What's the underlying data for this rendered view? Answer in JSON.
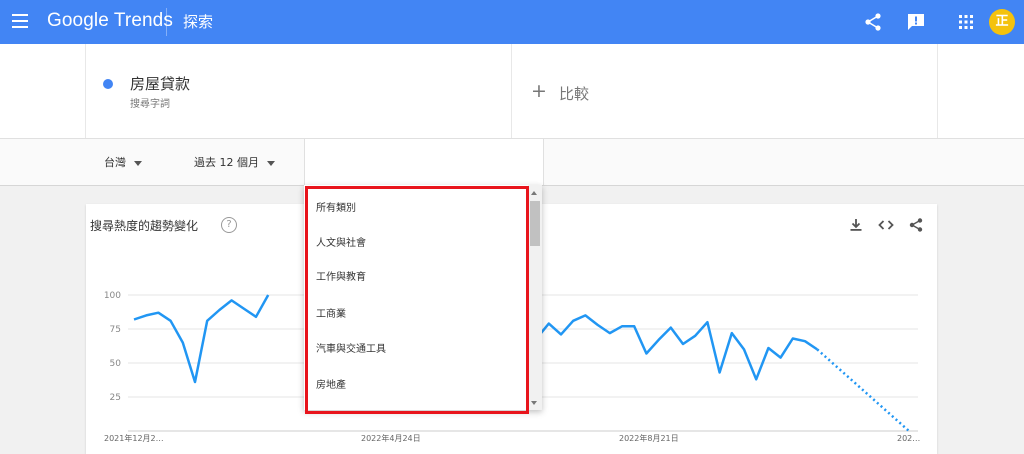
{
  "header": {
    "brand": "Google Trends",
    "section": "探索",
    "avatar_letter": "正",
    "icons": [
      "menu-icon",
      "share-icon",
      "feedback-icon",
      "apps-icon"
    ]
  },
  "search": {
    "term": "房屋貸款",
    "term_type": "搜尋字詞",
    "term_color": "#4285f4",
    "compare_label": "比較"
  },
  "filters": {
    "region": "台灣",
    "period": "過去 12 個月"
  },
  "category_dropdown": {
    "items": [
      "所有類別",
      "人文與社會",
      "工作與教育",
      "工商業",
      "汽車與交通工具",
      "房地產"
    ],
    "highlight_color": "#e8141c"
  },
  "chart_card": {
    "title": "搜尋熱度的趨勢變化",
    "help": "?",
    "actions": [
      "download-icon",
      "embed-icon",
      "share-icon"
    ]
  },
  "chart_data": {
    "type": "line",
    "y_ticks": [
      25,
      50,
      75,
      100
    ],
    "ylim": [
      0,
      100
    ],
    "x_labels": [
      "2021年12月2…",
      "2022年4月24日",
      "2022年8月21日",
      "202…"
    ],
    "series": [
      {
        "color": "#2196f3",
        "values": [
          82,
          85,
          87,
          81,
          65,
          36,
          81,
          89,
          96,
          90,
          84,
          100,
          null,
          null,
          null,
          null,
          null,
          null,
          null,
          null,
          null,
          null,
          null,
          null,
          null,
          null,
          null,
          null,
          null,
          null,
          null,
          null,
          null,
          68,
          79,
          71,
          81,
          85,
          78,
          72,
          77,
          77,
          57,
          67,
          76,
          64,
          70,
          80,
          43,
          72,
          60,
          38,
          61,
          54,
          68,
          66,
          60
        ],
        "partial_tail": [
          60,
          0
        ]
      }
    ]
  }
}
